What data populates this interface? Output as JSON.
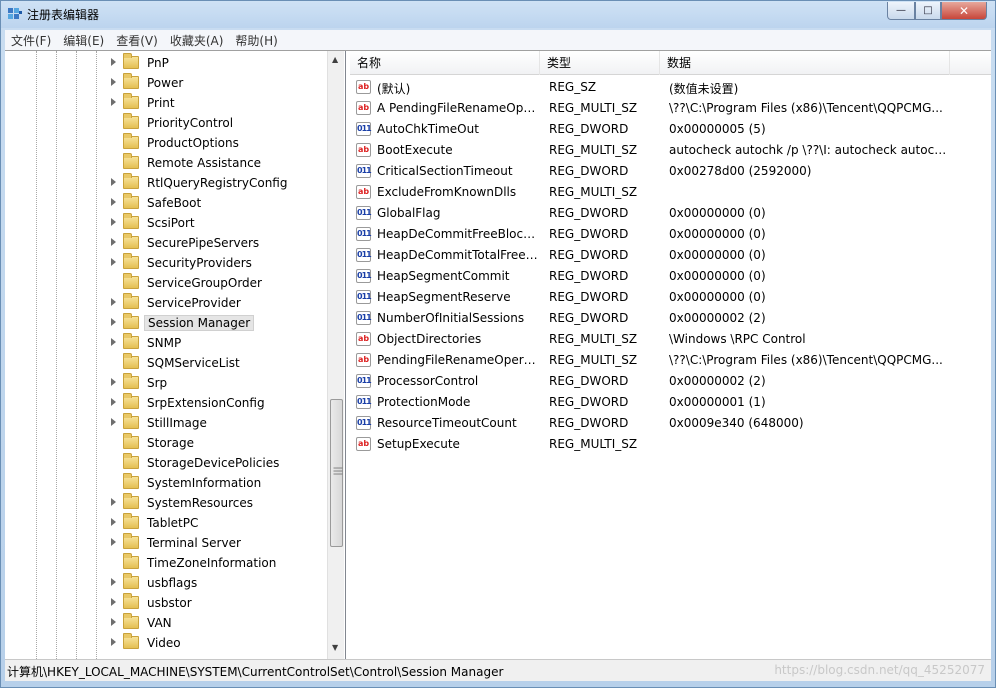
{
  "window": {
    "title": "注册表编辑器",
    "controls": {
      "minimize": "—",
      "maximize": "□",
      "close": "✕"
    }
  },
  "menubar": [
    "文件(F)",
    "编辑(E)",
    "查看(V)",
    "收藏夹(A)",
    "帮助(H)"
  ],
  "tree": {
    "items": [
      {
        "label": "PnP",
        "expandable": true
      },
      {
        "label": "Power",
        "expandable": true
      },
      {
        "label": "Print",
        "expandable": true
      },
      {
        "label": "PriorityControl",
        "expandable": false
      },
      {
        "label": "ProductOptions",
        "expandable": false
      },
      {
        "label": "Remote Assistance",
        "expandable": false
      },
      {
        "label": "RtlQueryRegistryConfig",
        "expandable": true
      },
      {
        "label": "SafeBoot",
        "expandable": true
      },
      {
        "label": "ScsiPort",
        "expandable": true
      },
      {
        "label": "SecurePipeServers",
        "expandable": true
      },
      {
        "label": "SecurityProviders",
        "expandable": true
      },
      {
        "label": "ServiceGroupOrder",
        "expandable": false
      },
      {
        "label": "ServiceProvider",
        "expandable": true
      },
      {
        "label": "Session Manager",
        "expandable": true,
        "selected": true
      },
      {
        "label": "SNMP",
        "expandable": true
      },
      {
        "label": "SQMServiceList",
        "expandable": false
      },
      {
        "label": "Srp",
        "expandable": true
      },
      {
        "label": "SrpExtensionConfig",
        "expandable": true
      },
      {
        "label": "StillImage",
        "expandable": true
      },
      {
        "label": "Storage",
        "expandable": false
      },
      {
        "label": "StorageDevicePolicies",
        "expandable": false
      },
      {
        "label": "SystemInformation",
        "expandable": false
      },
      {
        "label": "SystemResources",
        "expandable": true
      },
      {
        "label": "TabletPC",
        "expandable": true
      },
      {
        "label": "Terminal Server",
        "expandable": true
      },
      {
        "label": "TimeZoneInformation",
        "expandable": false
      },
      {
        "label": "usbflags",
        "expandable": true
      },
      {
        "label": "usbstor",
        "expandable": true
      },
      {
        "label": "VAN",
        "expandable": true
      },
      {
        "label": "Video",
        "expandable": true
      }
    ]
  },
  "list": {
    "headers": {
      "name": "名称",
      "type": "类型",
      "data": "数据"
    },
    "rows": [
      {
        "icon": "string-value-icon",
        "name": "(默认)",
        "type": "REG_SZ",
        "data": "(数值未设置)"
      },
      {
        "icon": "string-value-icon",
        "name": "A PendingFileRenameOper...",
        "type": "REG_MULTI_SZ",
        "data": "\\??\\C:\\Program Files (x86)\\Tencent\\QQPCMG..."
      },
      {
        "icon": "binary-value-icon",
        "name": "AutoChkTimeOut",
        "type": "REG_DWORD",
        "data": "0x00000005 (5)"
      },
      {
        "icon": "string-value-icon",
        "name": "BootExecute",
        "type": "REG_MULTI_SZ",
        "data": "autocheck autochk /p \\??\\I: autocheck autoch..."
      },
      {
        "icon": "binary-value-icon",
        "name": "CriticalSectionTimeout",
        "type": "REG_DWORD",
        "data": "0x00278d00 (2592000)"
      },
      {
        "icon": "string-value-icon",
        "name": "ExcludeFromKnownDlls",
        "type": "REG_MULTI_SZ",
        "data": ""
      },
      {
        "icon": "binary-value-icon",
        "name": "GlobalFlag",
        "type": "REG_DWORD",
        "data": "0x00000000 (0)"
      },
      {
        "icon": "binary-value-icon",
        "name": "HeapDeCommitFreeBlock...",
        "type": "REG_DWORD",
        "data": "0x00000000 (0)"
      },
      {
        "icon": "binary-value-icon",
        "name": "HeapDeCommitTotalFreeT...",
        "type": "REG_DWORD",
        "data": "0x00000000 (0)"
      },
      {
        "icon": "binary-value-icon",
        "name": "HeapSegmentCommit",
        "type": "REG_DWORD",
        "data": "0x00000000 (0)"
      },
      {
        "icon": "binary-value-icon",
        "name": "HeapSegmentReserve",
        "type": "REG_DWORD",
        "data": "0x00000000 (0)"
      },
      {
        "icon": "binary-value-icon",
        "name": "NumberOfInitialSessions",
        "type": "REG_DWORD",
        "data": "0x00000002 (2)"
      },
      {
        "icon": "string-value-icon",
        "name": "ObjectDirectories",
        "type": "REG_MULTI_SZ",
        "data": "\\Windows \\RPC Control"
      },
      {
        "icon": "string-value-icon",
        "name": "PendingFileRenameOperat...",
        "type": "REG_MULTI_SZ",
        "data": "\\??\\C:\\Program Files (x86)\\Tencent\\QQPCMG..."
      },
      {
        "icon": "binary-value-icon",
        "name": "ProcessorControl",
        "type": "REG_DWORD",
        "data": "0x00000002 (2)"
      },
      {
        "icon": "binary-value-icon",
        "name": "ProtectionMode",
        "type": "REG_DWORD",
        "data": "0x00000001 (1)"
      },
      {
        "icon": "binary-value-icon",
        "name": "ResourceTimeoutCount",
        "type": "REG_DWORD",
        "data": "0x0009e340 (648000)"
      },
      {
        "icon": "string-value-icon",
        "name": "SetupExecute",
        "type": "REG_MULTI_SZ",
        "data": ""
      }
    ]
  },
  "statusbar": {
    "path": "计算机\\HKEY_LOCAL_MACHINE\\SYSTEM\\CurrentControlSet\\Control\\Session Manager",
    "watermark": "https://blog.csdn.net/qq_45252077"
  },
  "icon_glyphs": {
    "string": "ab",
    "binary": "011"
  }
}
